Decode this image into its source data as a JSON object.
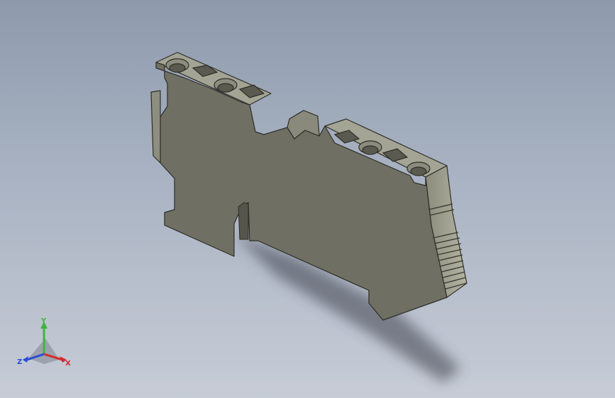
{
  "viewport": {
    "background_top": "#8e9aac",
    "background_bottom": "#c7ccd6"
  },
  "model": {
    "part": "terminal-block",
    "face_color": "#6f6f64",
    "side_color": "#9a9a8a",
    "edge_color": "#2e2e28",
    "shadow_color": "#3c414b"
  },
  "triad": {
    "y_label": "Y",
    "z_label": "Z",
    "x_label": "X",
    "y_color": "#3fb43f",
    "z_color": "#2a4bd6",
    "x_color": "#d42a2a"
  }
}
